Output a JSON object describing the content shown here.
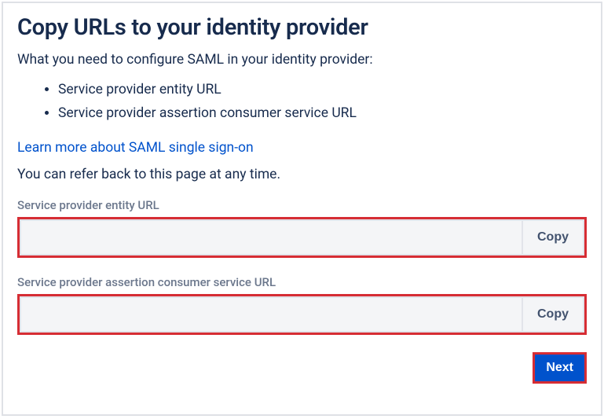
{
  "title": "Copy URLs to your identity provider",
  "intro": "What you need to configure SAML in your identity provider:",
  "bullets": [
    "Service provider entity URL",
    "Service provider assertion consumer service URL"
  ],
  "learn_more": "Learn more about SAML single sign-on",
  "note": "You can refer back to this page at any time.",
  "fields": {
    "entity": {
      "label": "Service provider entity URL",
      "value": "",
      "copy_label": "Copy"
    },
    "acs": {
      "label": "Service provider assertion consumer service URL",
      "value": "",
      "copy_label": "Copy"
    }
  },
  "next_label": "Next"
}
